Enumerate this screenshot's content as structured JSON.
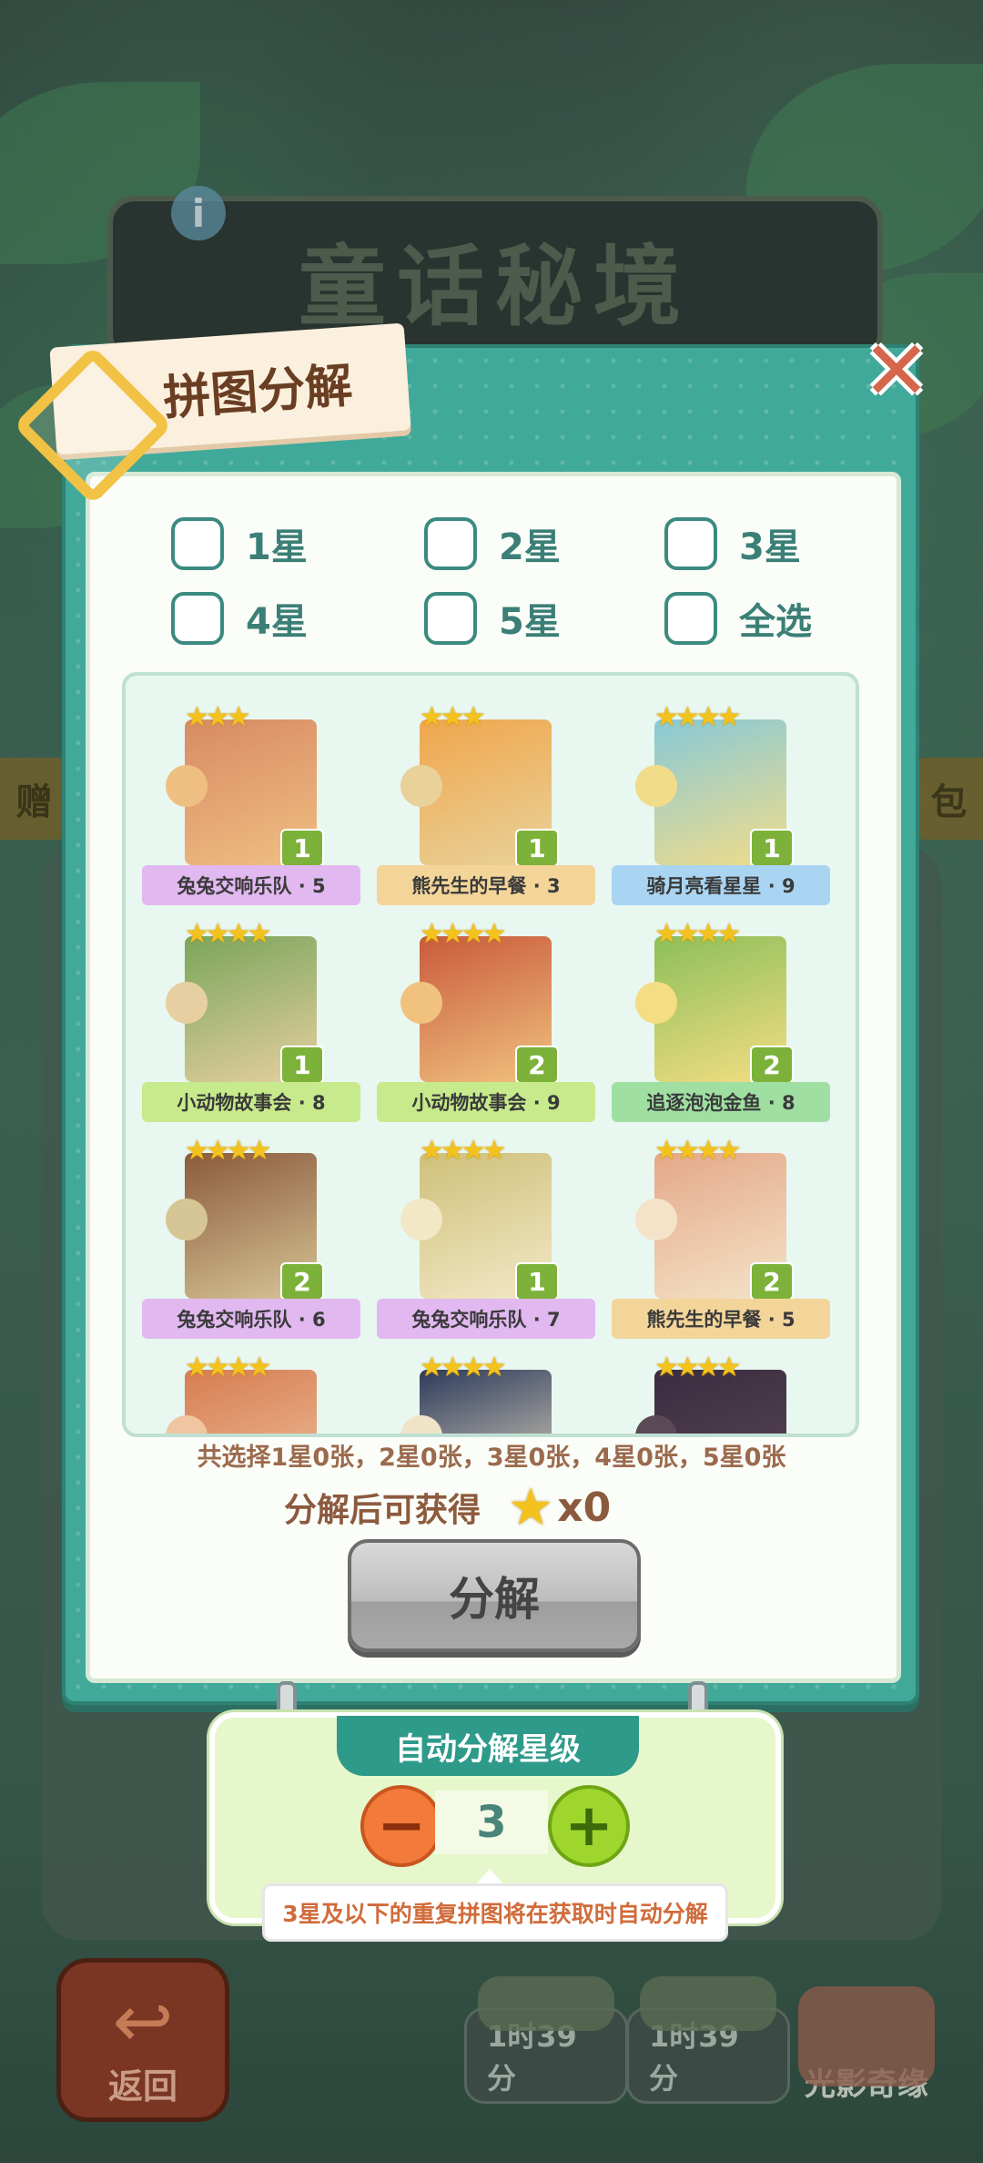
{
  "game_title": "童话秘境",
  "side_left": "赠",
  "side_right": "包",
  "modal": {
    "title": "拼图分解",
    "close_icon": "close-x-icon",
    "checkboxes": [
      {
        "label": "1星",
        "checked": false
      },
      {
        "label": "2星",
        "checked": false
      },
      {
        "label": "3星",
        "checked": false
      },
      {
        "label": "4星",
        "checked": false
      },
      {
        "label": "5星",
        "checked": false
      },
      {
        "label": "全选",
        "checked": false
      }
    ],
    "pieces": [
      {
        "stars": "★★★",
        "name": "兔兔交响乐队 · 5",
        "count": "1",
        "ribbon_color": "#e1b8f0",
        "img": [
          "#d88a64",
          "#efbf82"
        ]
      },
      {
        "stars": "★★★",
        "name": "熊先生的早餐 · 3",
        "count": "1",
        "ribbon_color": "#f3d599",
        "img": [
          "#f0a64c",
          "#e8d29a"
        ]
      },
      {
        "stars": "★★★★",
        "name": "骑月亮看星星 · 9",
        "count": "1",
        "ribbon_color": "#a9d5f2",
        "img": [
          "#88c9d6",
          "#f1dc8a"
        ]
      },
      {
        "stars": "★★★★",
        "name": "小动物故事会 · 8",
        "count": "1",
        "ribbon_color": "#c7ea8c",
        "img": [
          "#7aa55a",
          "#e6cfa1"
        ]
      },
      {
        "stars": "★★★★",
        "name": "小动物故事会 · 9",
        "count": "2",
        "ribbon_color": "#c7ea8c",
        "img": [
          "#c95a3c",
          "#f0c27e"
        ]
      },
      {
        "stars": "★★★★",
        "name": "追逐泡泡金鱼 · 8",
        "count": "2",
        "ribbon_color": "#9fe0a2",
        "img": [
          "#8cbf5a",
          "#f4dd83"
        ]
      },
      {
        "stars": "★★★★",
        "name": "兔兔交响乐队 · 6",
        "count": "2",
        "ribbon_color": "#e1b8f0",
        "img": [
          "#8b5a3c",
          "#d6c595"
        ]
      },
      {
        "stars": "★★★★",
        "name": "兔兔交响乐队 · 7",
        "count": "1",
        "ribbon_color": "#e1b8f0",
        "img": [
          "#cfc07a",
          "#f2e8c6"
        ]
      },
      {
        "stars": "★★★★",
        "name": "熊先生的早餐 · 5",
        "count": "2",
        "ribbon_color": "#f3d599",
        "img": [
          "#e4a888",
          "#f4e3c8"
        ]
      },
      {
        "stars": "★★★★",
        "name": "",
        "count": "",
        "ribbon_color": "",
        "img": [
          "#d77d52",
          "#f0c6a2"
        ]
      },
      {
        "stars": "★★★★",
        "name": "",
        "count": "",
        "ribbon_color": "",
        "img": [
          "#2d3b5c",
          "#f0e4c8"
        ]
      },
      {
        "stars": "★★★★",
        "name": "",
        "count": "",
        "ribbon_color": "",
        "img": [
          "#3a2c40",
          "#5b4a55"
        ]
      }
    ],
    "summary": "共选择1星0张，2星0张，3星0张，4星0张，5星0张",
    "gain_label": "分解后可获得",
    "gain_icon": "star-icon",
    "gain_value": "x0",
    "decompose_label": "分解"
  },
  "auto": {
    "title": "自动分解星级",
    "level": "3",
    "minus_icon": "minus-icon",
    "plus_icon": "plus-icon",
    "hint": "3星及以下的重复拼图将在获取时自动分解"
  },
  "bottom": {
    "back_label": "返回",
    "timer1": "1时39分",
    "timer2": "1时39分",
    "third_label": "光影奇缘"
  }
}
